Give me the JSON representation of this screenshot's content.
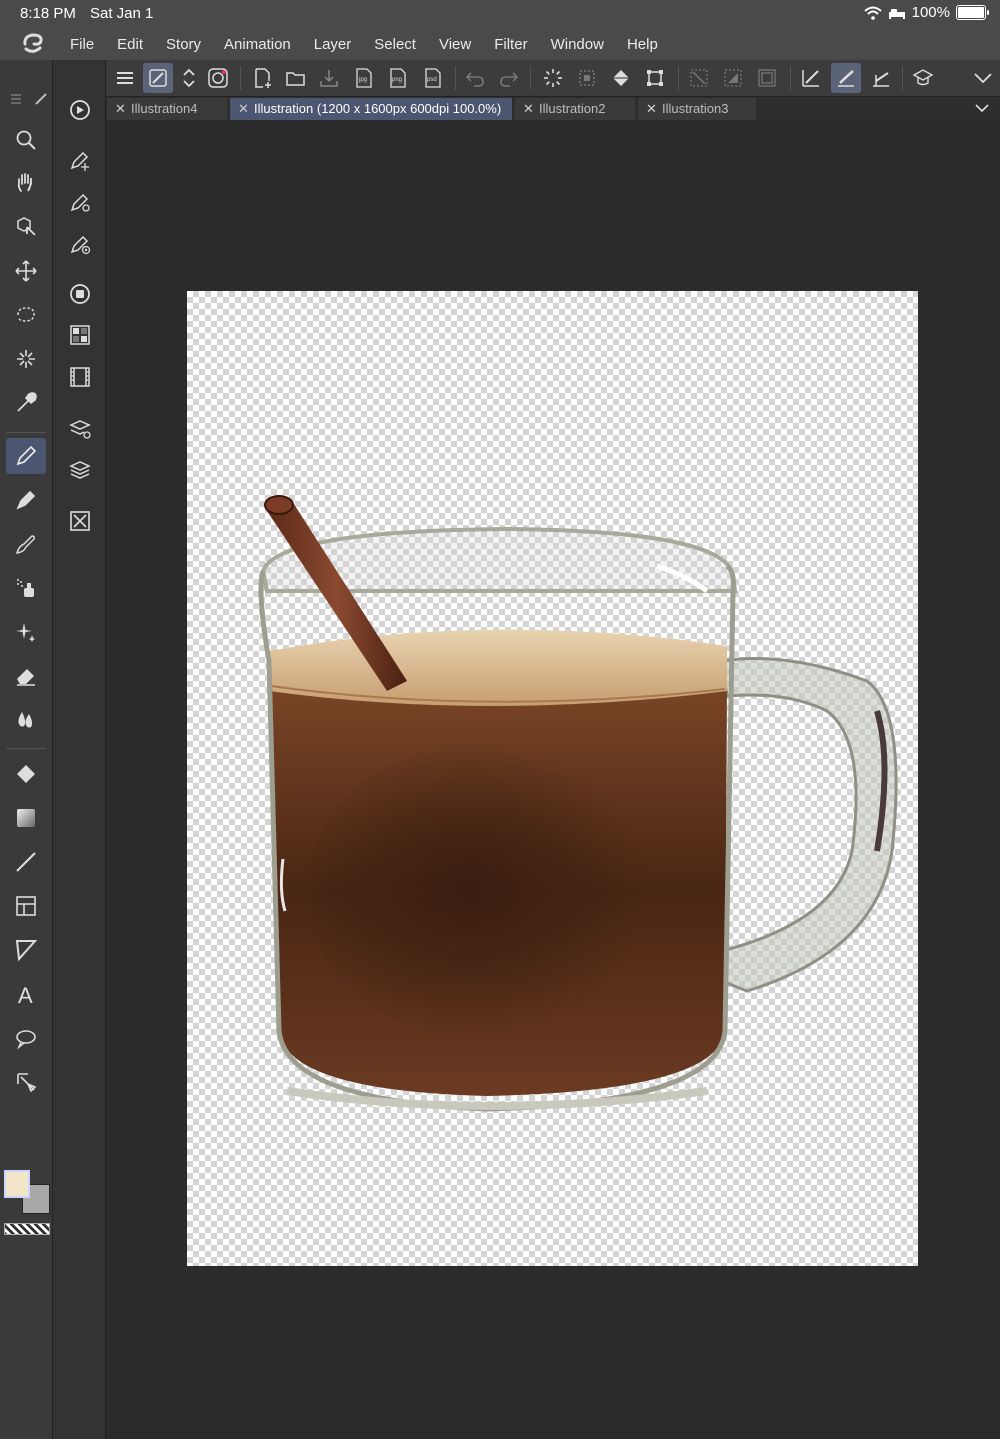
{
  "status": {
    "time": "8:18 PM",
    "date": "Sat Jan 1",
    "battery": "100%"
  },
  "menu": [
    "File",
    "Edit",
    "Story",
    "Animation",
    "Layer",
    "Select",
    "View",
    "Filter",
    "Window",
    "Help"
  ],
  "tabs": [
    {
      "label": "Illustration4",
      "active": false
    },
    {
      "label": "Illustration (1200 x 1600px 600dpi 100.0%)",
      "active": true
    },
    {
      "label": "Illustration2",
      "active": false
    },
    {
      "label": "Illustration3",
      "active": false
    }
  ],
  "command_icons": [
    "menu-icon",
    "snap-icon",
    "scroll-icon",
    "rotate-icon",
    "new-icon",
    "open-icon",
    "save-icon",
    "export-jpg-icon",
    "export-png-icon",
    "export-psd-icon",
    "undo-icon",
    "redo-icon",
    "select-loading-icon",
    "deselect-icon",
    "fill-icon",
    "transform-icon",
    "clip-icon",
    "reference-icon",
    "mask-icon",
    "ruler-snap-icon",
    "brush-snap-icon",
    "perspective-icon",
    "learn-icon",
    "more-icon"
  ],
  "tools": [
    "zoom-icon",
    "hand-icon",
    "object-icon",
    "move-icon",
    "lasso-select-icon",
    "auto-select-icon",
    "eyedropper-icon",
    "pen-icon",
    "pencil-icon",
    "brush-icon",
    "airbrush-icon",
    "decoration-icon",
    "eraser-icon",
    "blend-icon",
    "fill-icon",
    "gradient-icon",
    "line-icon",
    "frame-icon",
    "balloon-tail-icon",
    "text-icon",
    "balloon-icon",
    "correct-line-icon"
  ],
  "colors": {
    "main": "#f3e6c9",
    "sub": "#a8a8a8",
    "active": "#4d5670"
  }
}
